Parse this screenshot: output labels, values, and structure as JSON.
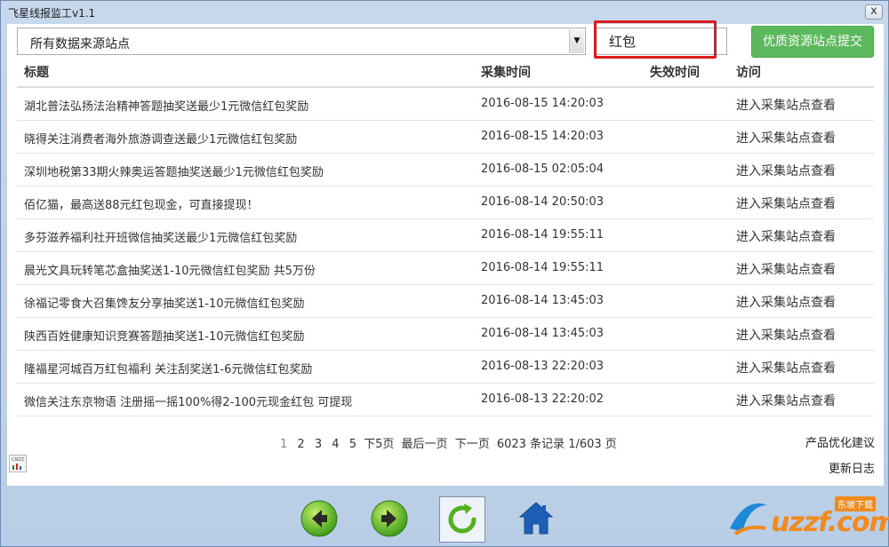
{
  "window": {
    "title": "飞星线报监工v1.1",
    "close_label": "x"
  },
  "filter": {
    "source_select": "所有数据来源站点",
    "search_value": "红包",
    "submit_label": "优质资源站点提交"
  },
  "table": {
    "headers": {
      "title": "标题",
      "collect_time": "采集时间",
      "expire_time": "失效时间",
      "visit": "访问"
    },
    "rows": [
      {
        "title": "湖北普法弘扬法治精神答题抽奖送最少1元微信红包奖励",
        "collect_time": "2016-08-15 14:20:03",
        "expire_time": "",
        "visit": "进入采集站点查看"
      },
      {
        "title": "晓得关注消费者海外旅游调查送最少1元微信红包奖励",
        "collect_time": "2016-08-15 14:20:03",
        "expire_time": "",
        "visit": "进入采集站点查看"
      },
      {
        "title": "深圳地税第33期火辣奥运答题抽奖送最少1元微信红包奖励",
        "collect_time": "2016-08-15 02:05:04",
        "expire_time": "",
        "visit": "进入采集站点查看"
      },
      {
        "title": "佰亿猫，最高送88元红包现金，可直接提现！",
        "collect_time": "2016-08-14 20:50:03",
        "expire_time": "",
        "visit": "进入采集站点查看"
      },
      {
        "title": "多芬滋养福利社开班微信抽奖送最少1元微信红包奖励",
        "collect_time": "2016-08-14 19:55:11",
        "expire_time": "",
        "visit": "进入采集站点查看"
      },
      {
        "title": "晨光文具玩转笔芯盒抽奖送1-10元微信红包奖励 共5万份",
        "collect_time": "2016-08-14 19:55:11",
        "expire_time": "",
        "visit": "进入采集站点查看"
      },
      {
        "title": "徐福记零食大召集馋友分享抽奖送1-10元微信红包奖励",
        "collect_time": "2016-08-14 13:45:03",
        "expire_time": "",
        "visit": "进入采集站点查看"
      },
      {
        "title": "陕西百姓健康知识竞赛答题抽奖送1-10元微信红包奖励",
        "collect_time": "2016-08-14 13:45:03",
        "expire_time": "",
        "visit": "进入采集站点查看"
      },
      {
        "title": "隆福星河城百万红包福利 关注刮奖送1-6元微信红包奖励",
        "collect_time": "2016-08-13 22:20:03",
        "expire_time": "",
        "visit": "进入采集站点查看"
      },
      {
        "title": "微信关注东京物语 注册摇一摇100%得2-100元现金红包 可提现",
        "collect_time": "2016-08-13 22:20:02",
        "expire_time": "",
        "visit": "进入采集站点查看"
      }
    ]
  },
  "pager": {
    "pages": [
      "1",
      "2",
      "3",
      "4",
      "5"
    ],
    "next5": "下5页",
    "last": "最后一页",
    "next": "下一页",
    "summary": "6023 条记录 1/603 页"
  },
  "side_links": {
    "feedback": "产品优化建议",
    "changelog": "更新日志"
  },
  "stat_label": "CNZZ",
  "toolbar": {
    "back_icon": "arrow-left-icon",
    "forward_icon": "arrow-right-icon",
    "refresh_icon": "refresh-icon",
    "home_icon": "home-icon"
  },
  "watermark": {
    "text": "uzzf.com",
    "tag": "东坡下载"
  },
  "colors": {
    "accent_green": "#5cb85c",
    "highlight_red": "#e0191a",
    "icon_green": "#3f9e1a",
    "home_blue": "#1c5fb5"
  }
}
